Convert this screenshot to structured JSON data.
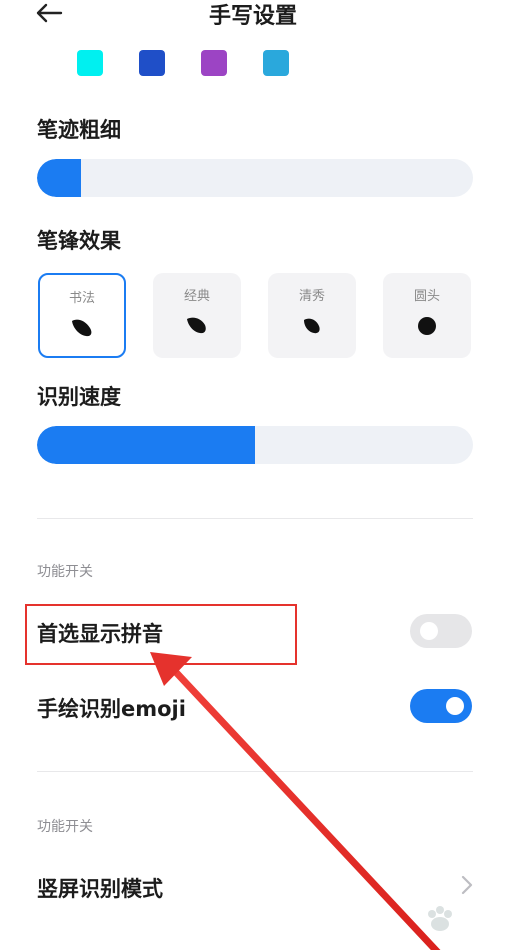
{
  "header": {
    "title": "手写设置",
    "back_icon": "arrow-left-icon"
  },
  "colors": {
    "swatches": [
      "#00f0f0",
      "#1f4fc8",
      "#9c44c4",
      "#2aa8dc"
    ],
    "accent": "#1b7cf2",
    "annotation_red": "#e5322d"
  },
  "stroke_width": {
    "label": "笔迹粗细",
    "level_fraction": 0.1
  },
  "pen_effect": {
    "label": "笔锋效果",
    "options": [
      {
        "label": "书法",
        "selected": true
      },
      {
        "label": "经典",
        "selected": false
      },
      {
        "label": "清秀",
        "selected": false
      },
      {
        "label": "圆头",
        "selected": false
      }
    ]
  },
  "recognition_speed": {
    "label": "识别速度",
    "level_fraction": 0.5
  },
  "section1": {
    "caption": "功能开关",
    "rows": [
      {
        "label": "首选显示拼音",
        "toggle_on": false
      },
      {
        "label": "手绘识别emoji",
        "toggle_on": true
      }
    ]
  },
  "section2": {
    "caption": "功能开关",
    "rows": [
      {
        "label": "竖屏识别模式",
        "icon": "chevron-right-icon"
      }
    ]
  }
}
